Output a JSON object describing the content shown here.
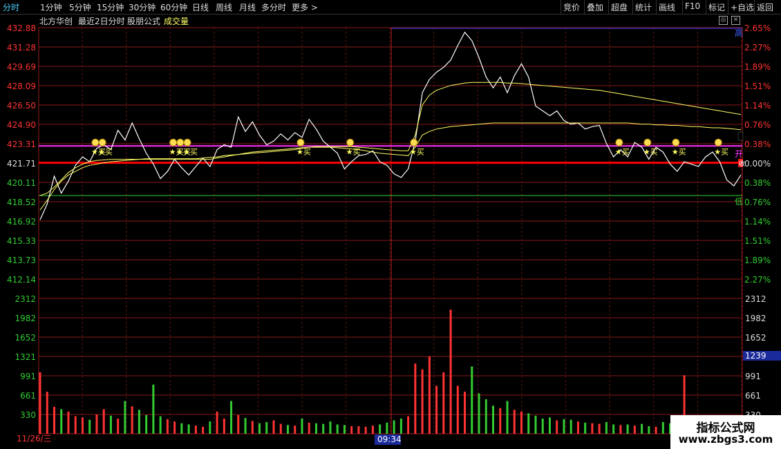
{
  "toolbar": {
    "left": [
      "分时",
      "1分钟",
      "5分钟",
      "15分钟",
      "30分钟",
      "60分钟",
      "日线",
      "周线",
      "月线",
      "多分时",
      "更多 >"
    ],
    "right": [
      "竞价",
      "叠加",
      "超盘",
      "统计",
      "画线",
      "F10",
      "标记",
      "+自选",
      "返回"
    ]
  },
  "titlebar": {
    "name": "北方华创",
    "mode": "最近2日分时",
    "formula": "股朋公式",
    "volume": "成交量"
  },
  "labels": {
    "high": "高",
    "open": "开",
    "low": "低",
    "close_marker": "收",
    "buy_signal": "★买",
    "date_left": "11/26/三",
    "cursor_time": "09:34",
    "current_volume": "1239"
  },
  "watermark": {
    "line1": "指标公式网",
    "line2": "www.zbgs3.com"
  },
  "colors": {
    "up": "#ff3333",
    "down": "#33cc33",
    "price_line": "#ffffff",
    "avg_line": "#ffff66",
    "resistance": "#ff33ff",
    "support": "#33cc33",
    "base": "#ff0000",
    "accent": "#4fd2ff"
  },
  "chart_data": {
    "type": "line",
    "price_ticks_left": [
      "432.88",
      "431.28",
      "429.69",
      "428.09",
      "426.50",
      "424.90",
      "423.31",
      "421.71",
      "420.11",
      "418.52",
      "416.92",
      "415.33",
      "413.73",
      "412.14"
    ],
    "pct_ticks_right": [
      "2.65%",
      "2.27%",
      "1.89%",
      "1.51%",
      "1.14%",
      "0.76%",
      "0.38%",
      "0.00%",
      "0.38%",
      "0.76%",
      "1.14%",
      "1.51%",
      "1.89%",
      "2.27%"
    ],
    "volume_ticks": [
      "2312",
      "1982",
      "1652",
      "1321",
      "991",
      "661",
      "330"
    ],
    "price_range": [
      411.3,
      432.88
    ],
    "base_price": 421.71,
    "resistance_price": 423.1,
    "support_price": 419.0,
    "series": [
      {
        "values": [
          417.0,
          418.3,
          420.6,
          419.2,
          420.2,
          421.5,
          422.2,
          421.8,
          422.9,
          423.2,
          422.8,
          424.4,
          423.6,
          425.0,
          423.7,
          422.5,
          421.6,
          420.4,
          421.0,
          422.0,
          421.3,
          420.7,
          421.4,
          422.1,
          421.4,
          422.8,
          423.2,
          423.0,
          425.5,
          424.3,
          425.1,
          424.0,
          423.2,
          423.5,
          424.1,
          423.6,
          424.2,
          423.8,
          425.3,
          424.5,
          423.5,
          423.0,
          422.5,
          421.2,
          421.8,
          422.3,
          422.4,
          422.7,
          421.8,
          421.5,
          420.8,
          420.5,
          421.2,
          423.5,
          427.5,
          428.6,
          429.2,
          429.6,
          430.2,
          431.4,
          432.5,
          431.8,
          430.4,
          428.8,
          427.9,
          428.8,
          427.5,
          428.9,
          429.9,
          428.8,
          426.4,
          426.0,
          425.6,
          426.0,
          425.2,
          424.9,
          425.0,
          424.5,
          424.7,
          424.8,
          423.3,
          422.2,
          422.8,
          422.2,
          423.4,
          423.0,
          422.0,
          423.0,
          422.6,
          421.6,
          421.0,
          421.8,
          421.6,
          421.4,
          422.2,
          422.6,
          421.8,
          420.3,
          419.8,
          420.7
        ]
      },
      {
        "values": [
          417.8,
          418.6,
          419.5,
          420.2,
          420.7,
          421.0,
          421.3,
          421.5,
          421.6,
          421.7,
          421.8,
          421.85,
          421.9,
          421.95,
          422.0,
          422.05,
          422.05,
          422.05,
          422.05,
          422.05,
          422.05,
          422.05,
          422.05,
          422.1,
          422.15,
          422.2,
          422.3,
          422.35,
          422.4,
          422.45,
          422.5,
          422.55,
          422.6,
          422.65,
          422.7,
          422.75,
          422.8,
          422.9,
          423.0,
          423.05,
          423.05,
          423.05,
          423.05,
          423.05,
          423.05,
          423.0,
          422.95,
          422.9,
          422.85,
          422.8,
          422.75,
          422.7,
          422.7,
          424.0,
          426.5,
          427.3,
          427.7,
          427.9,
          428.1,
          428.2,
          428.3,
          428.35,
          428.35,
          428.35,
          428.35,
          428.35,
          428.3,
          428.3,
          428.25,
          428.2,
          428.15,
          428.1,
          428.05,
          428.0,
          427.95,
          427.9,
          427.85,
          427.8,
          427.75,
          427.7,
          427.6,
          427.5,
          427.4,
          427.3,
          427.2,
          427.1,
          427.0,
          426.9,
          426.8,
          426.7,
          426.6,
          426.5,
          426.4,
          426.3,
          426.2,
          426.1,
          426.0,
          425.9,
          425.8,
          425.7
        ]
      },
      {
        "values": [
          419.0,
          419.2,
          419.7,
          420.3,
          420.9,
          421.3,
          421.6,
          421.8,
          421.9,
          421.95,
          422.0,
          422.0,
          422.0,
          422.0,
          422.0,
          422.0,
          422.0,
          422.0,
          422.0,
          422.0,
          422.0,
          422.0,
          422.0,
          422.0,
          422.0,
          422.1,
          422.2,
          422.3,
          422.4,
          422.5,
          422.6,
          422.65,
          422.7,
          422.75,
          422.8,
          422.85,
          422.9,
          422.95,
          423.0,
          423.0,
          423.0,
          423.0,
          422.95,
          422.9,
          422.85,
          422.8,
          422.7,
          422.6,
          422.5,
          422.45,
          422.4,
          422.35,
          422.3,
          423.0,
          424.0,
          424.3,
          424.5,
          424.6,
          424.7,
          424.75,
          424.8,
          424.85,
          424.9,
          424.95,
          425.0,
          425.0,
          425.0,
          425.0,
          425.0,
          425.0,
          425.0,
          425.0,
          425.0,
          425.0,
          425.0,
          425.0,
          425.0,
          425.0,
          425.0,
          425.0,
          425.0,
          425.0,
          425.0,
          425.0,
          424.95,
          424.9,
          424.9,
          424.85,
          424.85,
          424.8,
          424.8,
          424.75,
          424.7,
          424.7,
          424.65,
          424.6,
          424.6,
          424.55,
          424.5,
          424.45
        ]
      }
    ],
    "volume_values": [
      1050,
      720,
      460,
      420,
      380,
      300,
      280,
      240,
      330,
      420,
      310,
      260,
      560,
      470,
      410,
      320,
      840,
      300,
      250,
      210,
      180,
      160,
      140,
      120,
      210,
      380,
      260,
      560,
      320,
      270,
      220,
      180,
      200,
      230,
      170,
      150,
      140,
      260,
      190,
      180,
      170,
      210,
      160,
      150,
      130,
      130,
      120,
      140,
      160,
      190,
      230,
      260,
      300,
      1200,
      1100,
      1320,
      820,
      1050,
      2120,
      820,
      720,
      1150,
      690,
      590,
      480,
      440,
      560,
      410,
      380,
      350,
      310,
      260,
      280,
      230,
      250,
      240,
      210,
      190,
      180,
      170,
      200,
      160,
      150,
      160,
      140,
      170,
      130,
      120,
      200,
      180,
      150,
      1000,
      140,
      120,
      130,
      150,
      170,
      180,
      190,
      210
    ],
    "buy_signal_indices": [
      8,
      9,
      19,
      20,
      21,
      37,
      44,
      53,
      82,
      86,
      90,
      96
    ]
  }
}
